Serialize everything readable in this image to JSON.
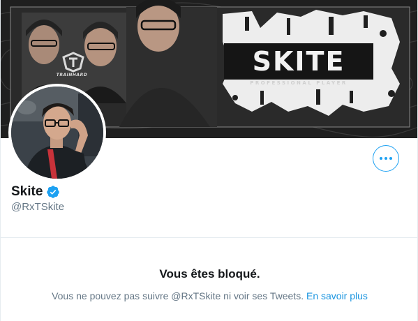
{
  "banner": {
    "title": "SKITE",
    "subtitle": "PROFESSIONAL PLAYER",
    "team_logo_text": "TRAINHARD"
  },
  "profile": {
    "display_name": "Skite",
    "handle": "@RxTSkite",
    "verified": true,
    "more_icon": "more-horizontal-icon",
    "accent_color": "#1da1f2"
  },
  "blocked": {
    "title": "Vous êtes bloqué.",
    "message": "Vous ne pouvez pas suivre @RxTSkite ni voir ses Tweets.",
    "learn_more": "En savoir plus"
  }
}
